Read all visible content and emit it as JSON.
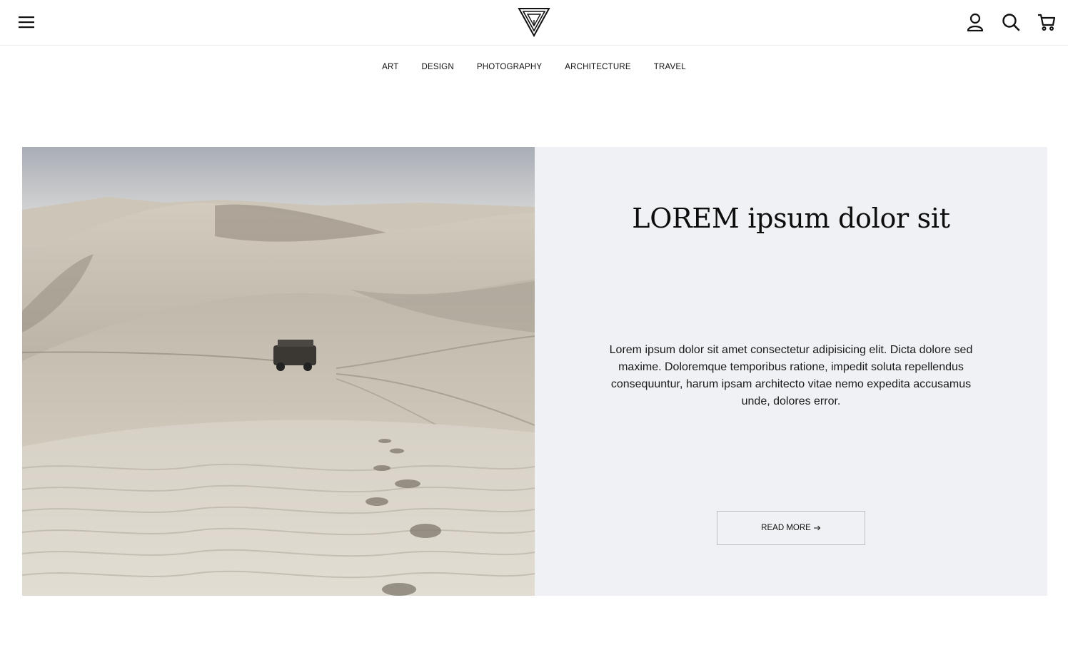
{
  "header": {
    "menu_icon": "hamburger-menu-icon",
    "logo_icon": "triangle-logo-icon",
    "icons": [
      "user-icon",
      "search-icon",
      "cart-icon"
    ]
  },
  "nav": {
    "items": [
      {
        "label": "ART"
      },
      {
        "label": "DESIGN"
      },
      {
        "label": "PHOTOGRAPHY"
      },
      {
        "label": "ARCHITECTURE"
      },
      {
        "label": "TRAVEL"
      }
    ]
  },
  "hero": {
    "image_icon": "desert-dunes-photo",
    "title": "LOREM ipsum dolor sit",
    "text": "Lorem ipsum dolor sit amet consectetur adipisicing elit. Dicta dolore sed maxime. Doloremque temporibus ratione, impedit soluta repellendus consequuntur, harum ipsam architecto vitae nemo expedita accusamus unde, dolores error.",
    "button_label": "READ MORE",
    "button_icon": "arrow-right-icon"
  },
  "colors": {
    "panel_bg": "#f0f1f5",
    "text": "#111111"
  }
}
